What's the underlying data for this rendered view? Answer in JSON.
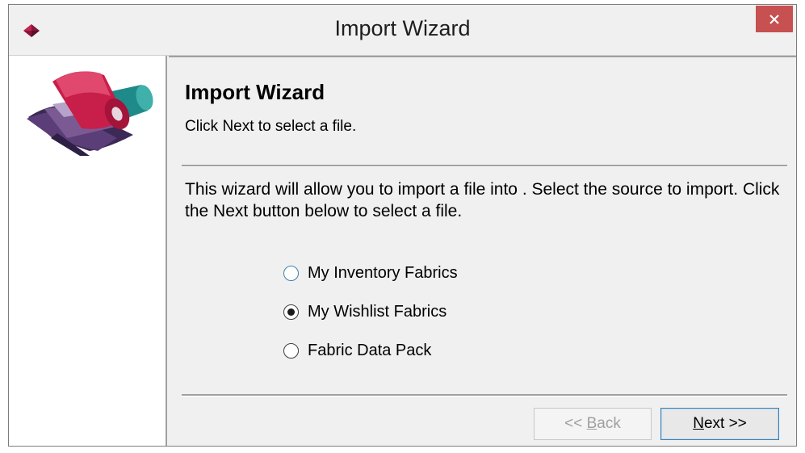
{
  "window": {
    "title": "Import Wizard",
    "close_icon": "close-icon",
    "app_icon": "fabric-bolt-icon",
    "close_color": "#c75050"
  },
  "header": {
    "title": "Import Wizard",
    "subtitle": "Click Next to select a file."
  },
  "body": {
    "description": "This wizard will allow you to import a file into .  Select the source to import.  Click the Next button below to select a file."
  },
  "options": [
    {
      "label": "My Inventory Fabrics",
      "checked": false
    },
    {
      "label": "My Wishlist Fabrics",
      "checked": true
    },
    {
      "label": "Fabric Data Pack",
      "checked": false
    }
  ],
  "buttons": {
    "back": {
      "prefix": "<< ",
      "mnemonic": "B",
      "rest": "ack",
      "enabled": false
    },
    "next": {
      "mnemonic": "N",
      "rest": "ext >>",
      "enabled": true
    }
  },
  "logo": {
    "icon": "fabric-rolls-logo"
  }
}
